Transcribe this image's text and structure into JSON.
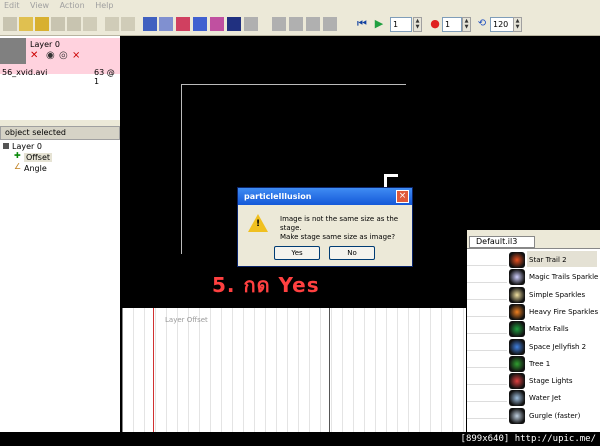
{
  "menu": [
    "Edit",
    "View",
    "Action",
    "Help"
  ],
  "toolbar": {
    "frame_start": "1",
    "frame_current": "1",
    "fps": "120"
  },
  "layer": {
    "name": "Layer 0",
    "file": "56_xvid.avi",
    "frame_info": "63 @ 1"
  },
  "object_panel": {
    "title": "object selected"
  },
  "tree": {
    "root": "Layer 0",
    "children": [
      "Offset",
      "Angle"
    ]
  },
  "timeline": {
    "label": "Layer Offset"
  },
  "library": {
    "tab": "Default.il3",
    "items": [
      {
        "label": "Star Trail 2",
        "color": "#e85020"
      },
      {
        "label": "Magic Trails Sparkle",
        "color": "#d0d0ff"
      },
      {
        "label": "Simple Sparkles",
        "color": "#f0e0a0"
      },
      {
        "label": "Heavy Fire Sparkles",
        "color": "#f08020"
      },
      {
        "label": "Matrix Falls",
        "color": "#20a040"
      },
      {
        "label": "Space Jellyfish 2",
        "color": "#4080e0"
      },
      {
        "label": "Tree 1",
        "color": "#30a030"
      },
      {
        "label": "Stage Lights",
        "color": "#e04040"
      },
      {
        "label": "Water Jet",
        "color": "#a0c0e0"
      },
      {
        "label": "Gurgle (faster)",
        "color": "#c0d0e0"
      }
    ]
  },
  "dialog": {
    "title": "particleIllusion",
    "message_line1": "Image is not the same size as the stage.",
    "message_line2": "Make stage same size as image?",
    "yes": "Yes",
    "no": "No"
  },
  "annotation": "5. กด Yes",
  "footer": "[899x640] http://upic.me/"
}
